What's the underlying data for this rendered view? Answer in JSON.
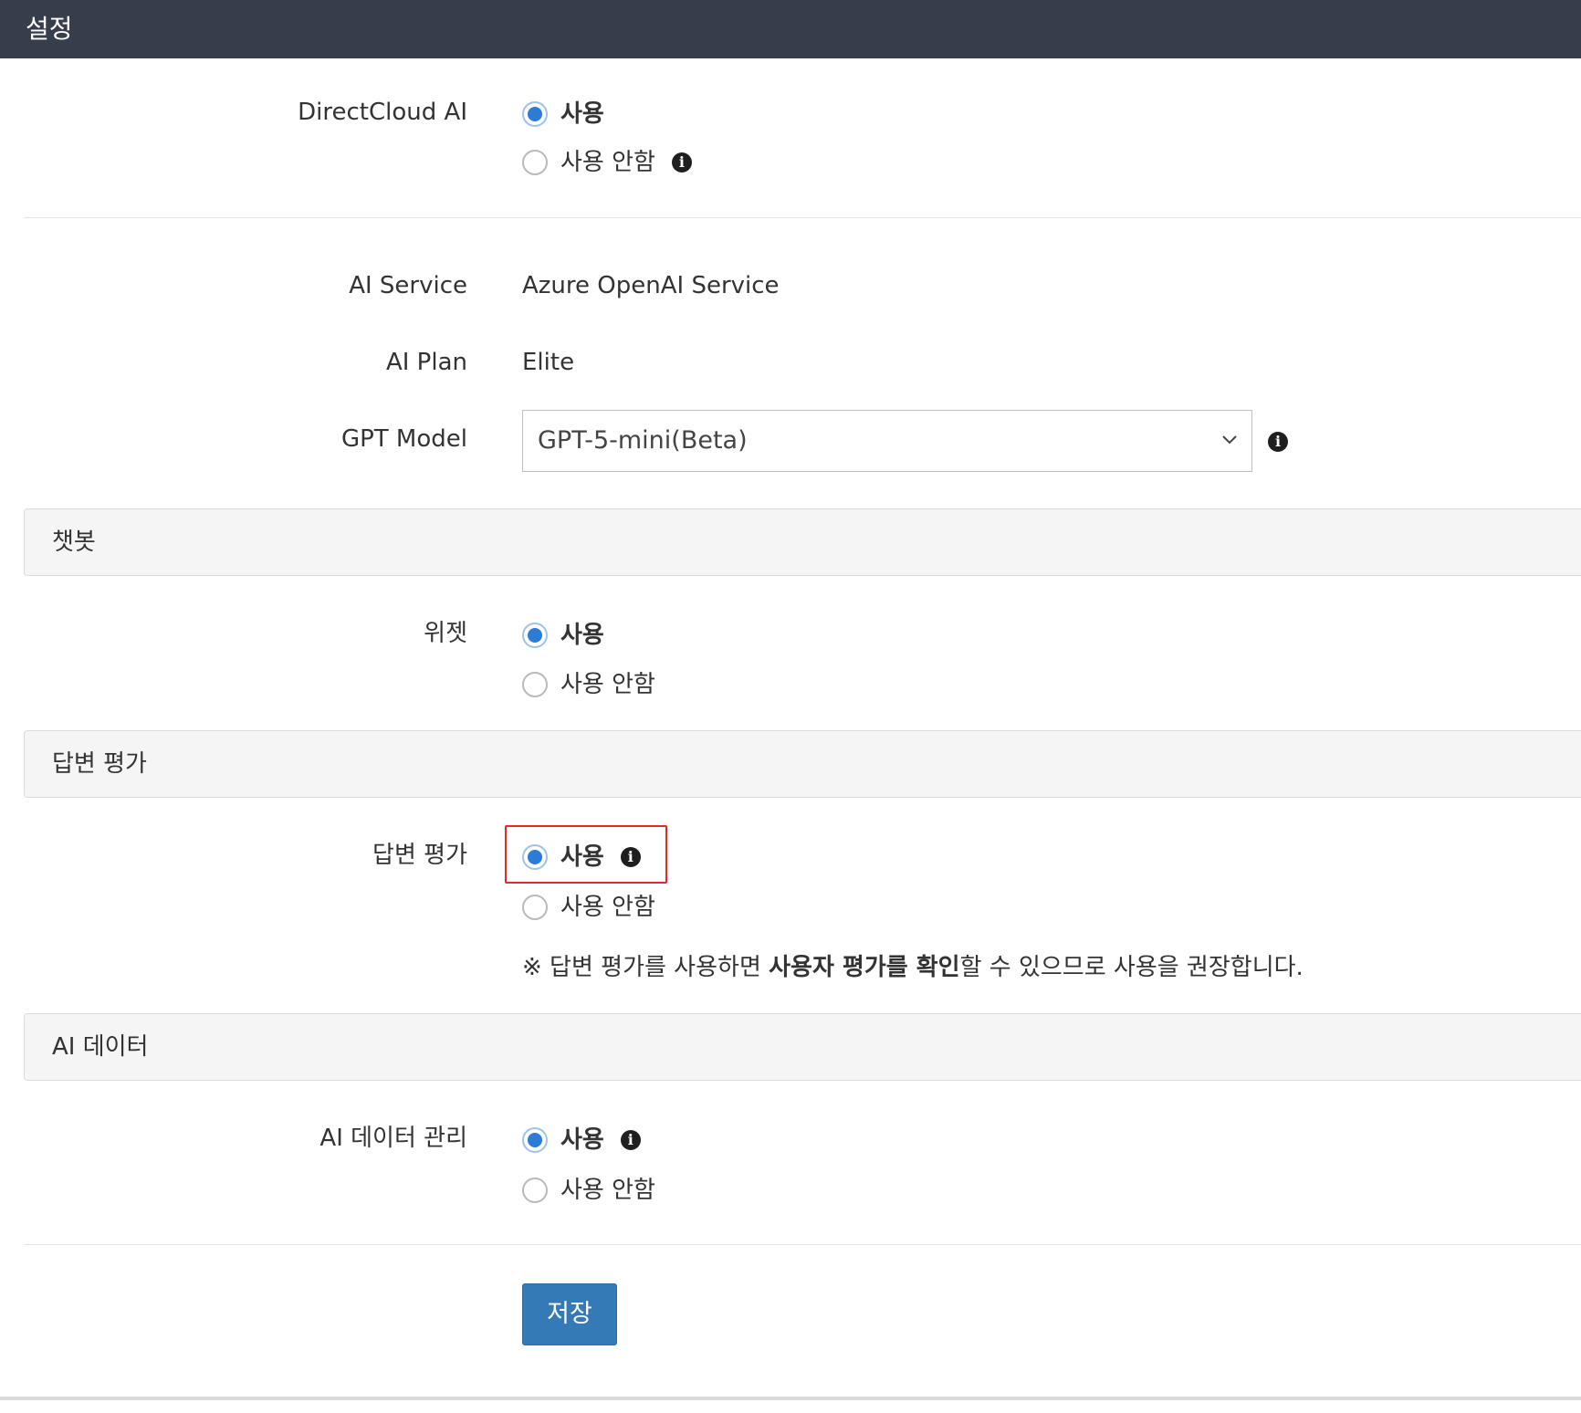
{
  "header": {
    "title": "설정"
  },
  "directcloud_ai": {
    "label": "DirectCloud AI",
    "options": [
      {
        "label": "사용",
        "checked": true
      },
      {
        "label": "사용 안함",
        "checked": false
      }
    ]
  },
  "ai_service": {
    "label": "AI Service",
    "value": "Azure OpenAI Service"
  },
  "ai_plan": {
    "label": "AI Plan",
    "value": "Elite"
  },
  "gpt_model": {
    "label": "GPT Model",
    "selected": "GPT-5-mini(Beta)"
  },
  "sections": {
    "chatbot": {
      "title": "챗봇",
      "widget": {
        "label": "위젯",
        "options": [
          {
            "label": "사용",
            "checked": true
          },
          {
            "label": "사용 안함",
            "checked": false
          }
        ]
      }
    },
    "answer_rating": {
      "title": "답변 평가",
      "rating": {
        "label": "답변 평가",
        "options": [
          {
            "label": "사용",
            "checked": true
          },
          {
            "label": "사용 안함",
            "checked": false
          }
        ]
      },
      "note": {
        "prefix": "※ 답변 평가를 사용하면 ",
        "bold": "사용자 평가를 확인",
        "suffix": "할 수 있으므로 사용을 권장합니다."
      }
    },
    "ai_data": {
      "title": "AI 데이터",
      "manage": {
        "label": "AI 데이터 관리",
        "options": [
          {
            "label": "사용",
            "checked": true
          },
          {
            "label": "사용 안함",
            "checked": false
          }
        ]
      }
    }
  },
  "buttons": {
    "save": "저장"
  },
  "icons": {
    "info": "info-icon",
    "dropdown": "chevron-down-icon"
  },
  "colors": {
    "header_bg": "#363d4b",
    "accent": "#2c7bd6",
    "button": "#337ab7",
    "highlight": "#e02b2b"
  }
}
